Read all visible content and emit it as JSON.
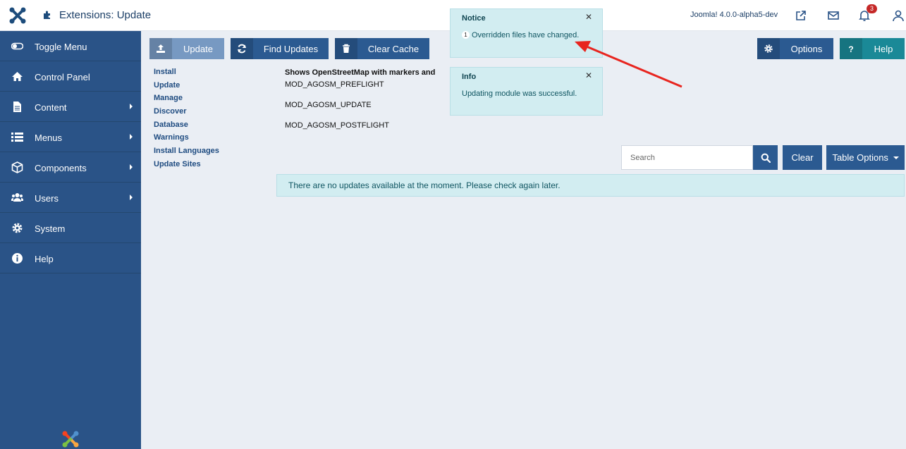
{
  "header": {
    "title": "Extensions: Update",
    "version": "Joomla! 4.0.0-alpha5-dev",
    "notification_count": "3"
  },
  "sidebar": {
    "items": [
      {
        "label": "Toggle Menu"
      },
      {
        "label": "Control Panel"
      },
      {
        "label": "Content"
      },
      {
        "label": "Menus"
      },
      {
        "label": "Components"
      },
      {
        "label": "Users"
      },
      {
        "label": "System"
      },
      {
        "label": "Help"
      }
    ]
  },
  "toolbar": {
    "update_label": "Update",
    "find_updates_label": "Find Updates",
    "clear_cache_label": "Clear Cache",
    "options_label": "Options",
    "help_label": "Help"
  },
  "submenu": {
    "items": [
      "Install",
      "Update",
      "Manage",
      "Discover",
      "Database",
      "Warnings",
      "Install Languages",
      "Update Sites"
    ]
  },
  "details": {
    "title": "Shows OpenStreetMap with markers and",
    "lines": [
      "MOD_AGOSM_PREFLIGHT",
      "MOD_AGOSM_UPDATE",
      "MOD_AGOSM_POSTFLIGHT"
    ]
  },
  "toasts": {
    "notice": {
      "title": "Notice",
      "count": "1",
      "message": "Overridden files have changed."
    },
    "info": {
      "title": "Info",
      "message": "Updating module was successful."
    }
  },
  "search": {
    "placeholder": "Search",
    "clear_label": "Clear",
    "table_options_label": "Table Options"
  },
  "alert": {
    "message": "There are no updates available at the moment. Please check again later."
  },
  "colors": {
    "sidebar": "#2a5387",
    "primary": "#2b5a91",
    "help": "#1a8997",
    "toast": "#d2edf1",
    "annotation": "#e8251f"
  }
}
